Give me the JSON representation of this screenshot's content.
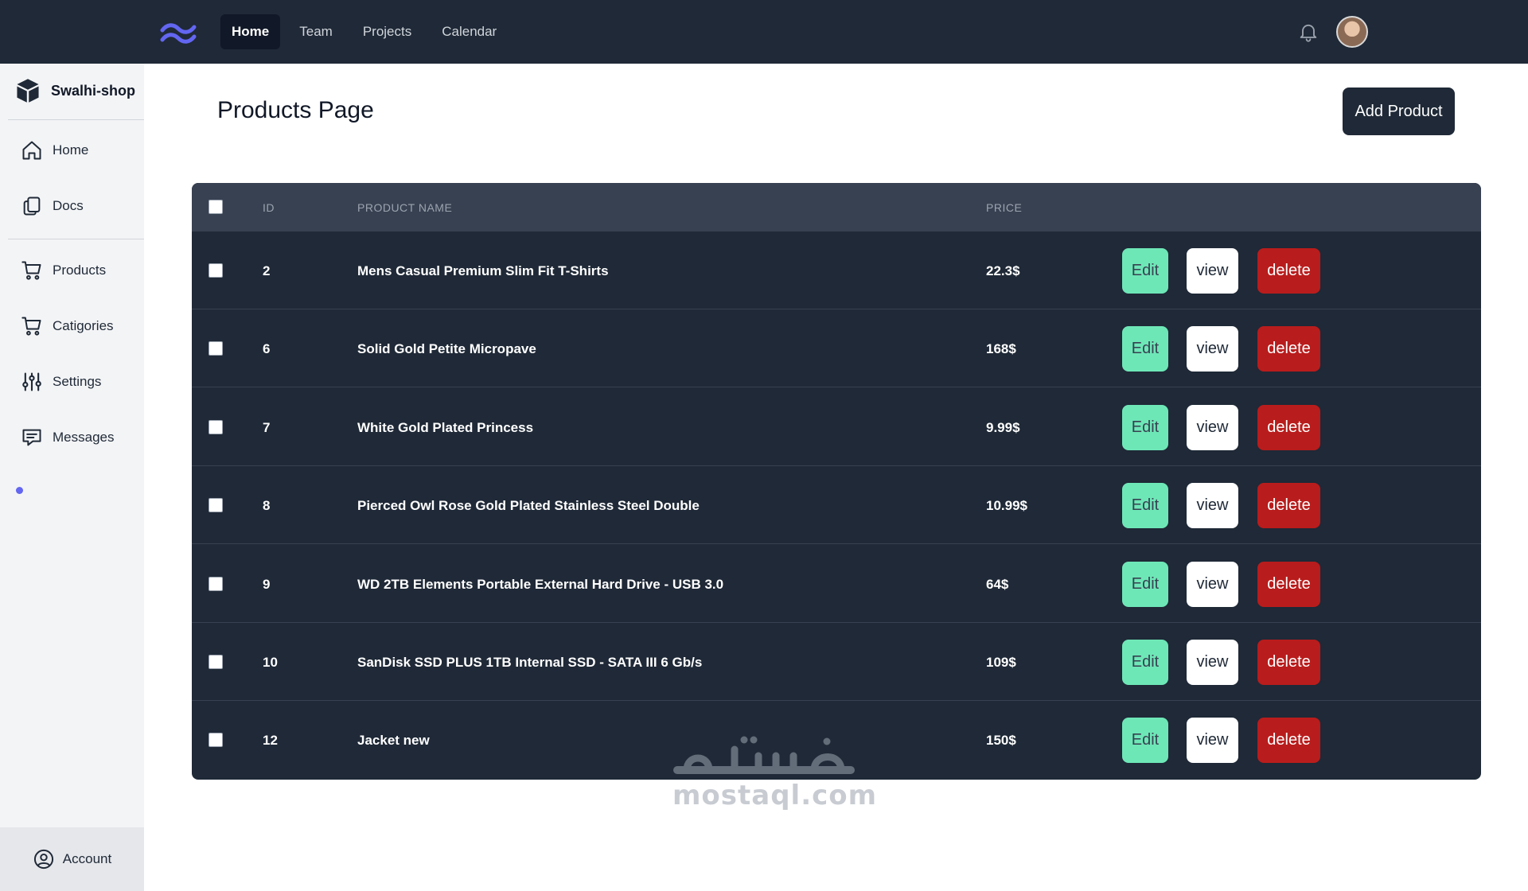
{
  "topbar": {
    "nav": [
      "Home",
      "Team",
      "Projects",
      "Calendar"
    ],
    "active_index": 0,
    "bg_color": "#1f2937"
  },
  "sidebar": {
    "brand": "Swalhi-shop",
    "items": [
      {
        "label": "Home",
        "icon": "home-icon"
      },
      {
        "label": "Docs",
        "icon": "docs-icon"
      },
      {
        "label": "Products",
        "icon": "cart-icon"
      },
      {
        "label": "Catigories",
        "icon": "cart-icon"
      },
      {
        "label": "Settings",
        "icon": "sliders-icon"
      },
      {
        "label": "Messages",
        "icon": "chat-icon"
      }
    ],
    "account": "Account"
  },
  "main": {
    "title": "Products Page",
    "add_button": "Add Product",
    "table": {
      "headers": {
        "id": "ID",
        "name": "PRODUCT NAME",
        "price": "PRICE"
      },
      "actions": {
        "edit": "Edit",
        "view": "view",
        "delete": "delete"
      },
      "rows": [
        {
          "id": "2",
          "name": "Mens Casual Premium Slim Fit T-Shirts",
          "price": "22.3$"
        },
        {
          "id": "6",
          "name": "Solid Gold Petite Micropave",
          "price": "168$"
        },
        {
          "id": "7",
          "name": "White Gold Plated Princess",
          "price": "9.99$"
        },
        {
          "id": "8",
          "name": "Pierced Owl Rose Gold Plated Stainless Steel Double",
          "price": "10.99$"
        },
        {
          "id": "9",
          "name": "WD 2TB Elements Portable External Hard Drive - USB 3.0",
          "price": "64$"
        },
        {
          "id": "10",
          "name": "SanDisk SSD PLUS 1TB Internal SSD - SATA III 6 Gb/s",
          "price": "109$"
        },
        {
          "id": "12",
          "name": "Jacket new",
          "price": "150$"
        }
      ]
    }
  },
  "watermark": {
    "latin": "mostaql.com"
  },
  "colors": {
    "edit": "#6ee7b7",
    "delete": "#b91c1c",
    "view": "#ffffff",
    "table_bg": "#1f2937"
  }
}
